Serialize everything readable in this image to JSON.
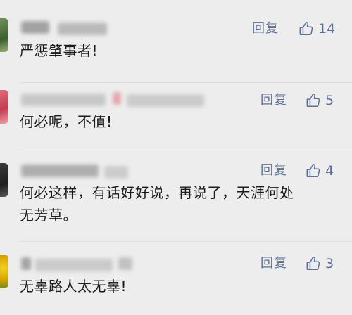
{
  "comments": [
    {
      "text": "严惩肇事者!",
      "reply_label": "回复",
      "like_count": "14"
    },
    {
      "text": "何必呢，不值!",
      "reply_label": "回复",
      "like_count": "5"
    },
    {
      "text": "何必这样，有话好好说，再说了，天涯何处\n无芳草。",
      "reply_label": "回复",
      "like_count": "4"
    },
    {
      "text": "无辜路人太无辜!",
      "reply_label": "回复",
      "like_count": "3"
    }
  ],
  "icons": {
    "like": "thumbs-up-outline-icon"
  },
  "colors": {
    "background": "#ededed",
    "link": "#5b6f96",
    "text": "#1b1b1b"
  }
}
